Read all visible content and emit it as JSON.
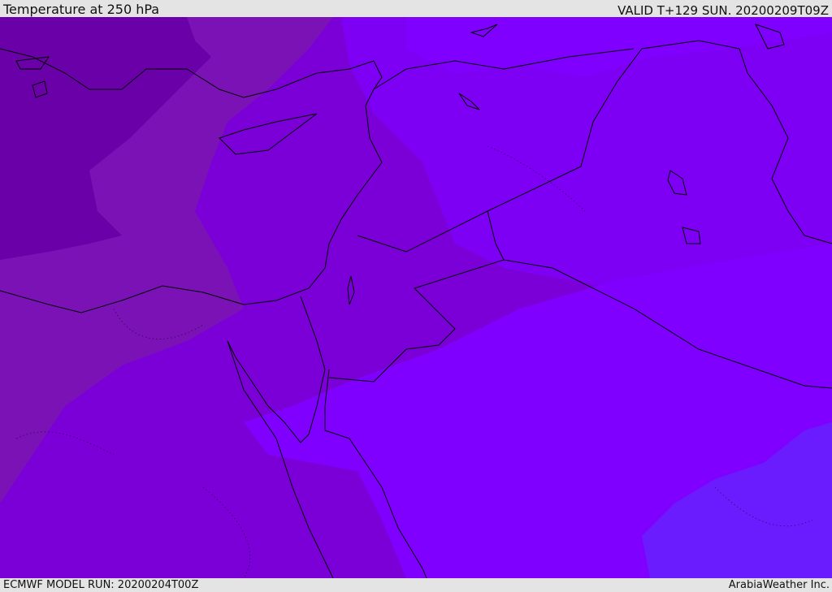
{
  "header": {
    "title": "Temperature at 250 hPa",
    "valid_time": "VALID T+129 SUN. 20200209T09Z"
  },
  "footer": {
    "model_run": "ECMWF MODEL RUN: 20200204T00Z",
    "credit": "ArabiaWeather Inc."
  },
  "map": {
    "variable": "temperature",
    "level": "250 hPa",
    "colors": {
      "band_darkest": "#6a00a8",
      "band_dark": "#7a12b6",
      "band_mid": "#7b00d8",
      "band_light": "#7d00f4",
      "band_lightest": "#8000ff",
      "band_blue": "#6b1cff",
      "coastline": "#000000"
    }
  }
}
